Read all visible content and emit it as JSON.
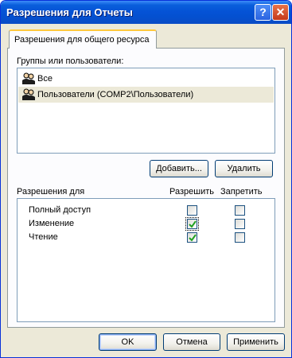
{
  "window": {
    "title": "Разрешения для Отчеты",
    "help_glyph": "?",
    "close_glyph": "✕"
  },
  "tab": {
    "label": "Разрешения для общего ресурса"
  },
  "groups": {
    "label": "Группы или пользователи:",
    "items": [
      {
        "name": "Все",
        "icon": "users-group-icon",
        "selected": false
      },
      {
        "name": "Пользователи (COMP2\\Пользователи)",
        "icon": "users-group-icon",
        "selected": true
      }
    ],
    "add_button": "Добавить...",
    "remove_button": "Удалить"
  },
  "permissions": {
    "header_label": "Разрешения для",
    "allow_header": "Разрешить",
    "deny_header": "Запретить",
    "rows": [
      {
        "name": "Полный доступ",
        "allow": false,
        "deny": false
      },
      {
        "name": "Изменение",
        "allow": true,
        "deny": false
      },
      {
        "name": "Чтение",
        "allow": true,
        "deny": false
      }
    ]
  },
  "footer": {
    "ok": "OK",
    "cancel": "Отмена",
    "apply": "Применить"
  },
  "colors": {
    "titlebar": "#0553d6",
    "check": "#21a121",
    "window_bg": "#ece9d8"
  }
}
